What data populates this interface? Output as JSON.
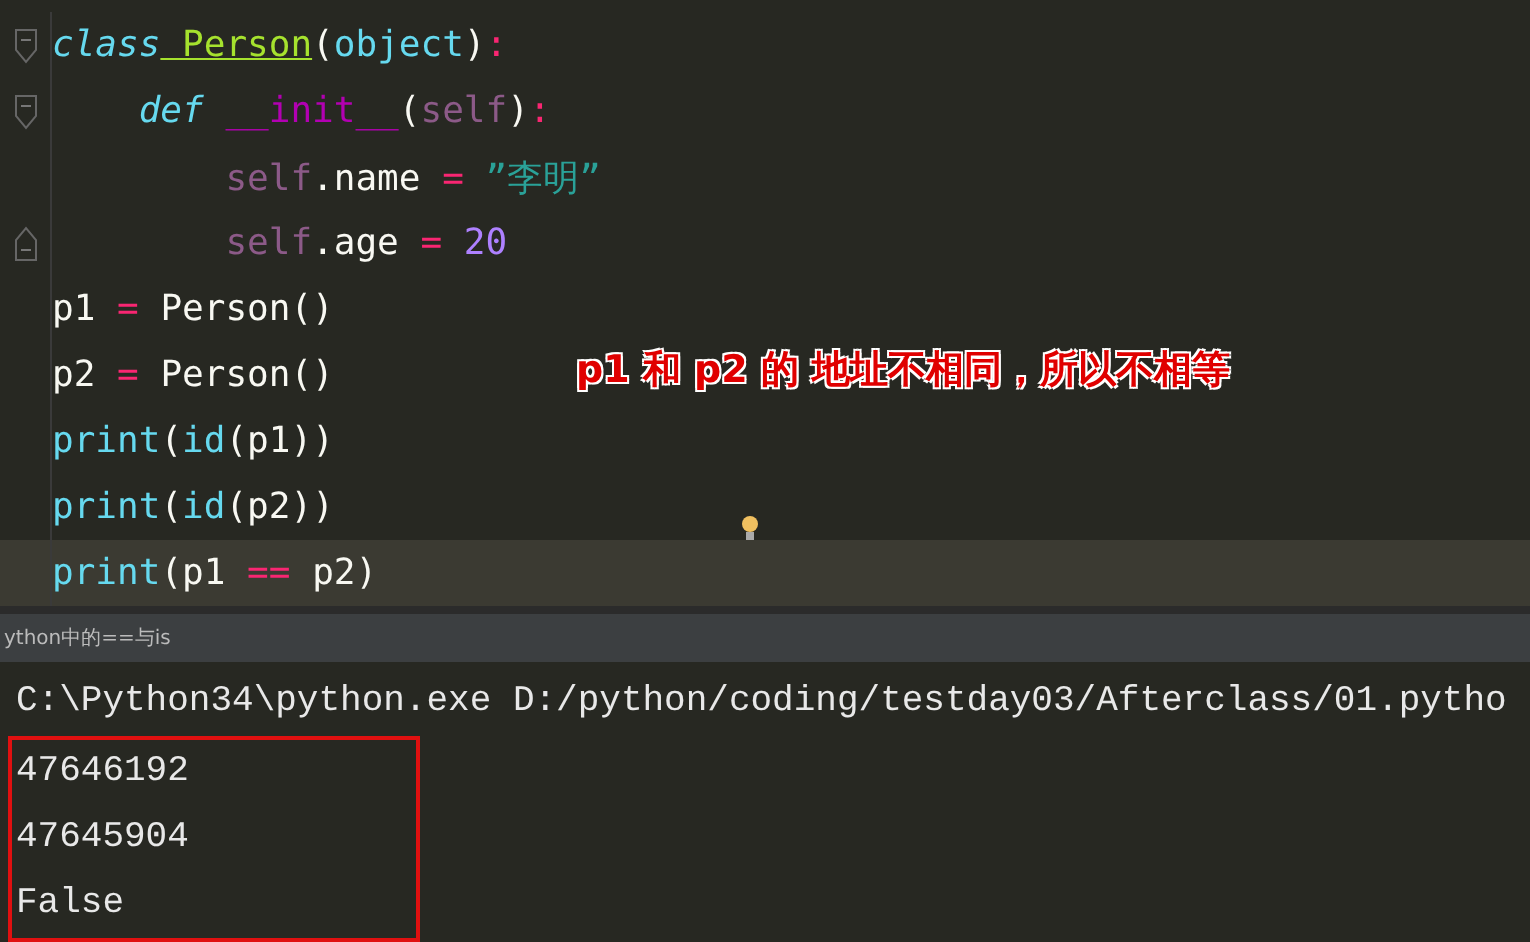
{
  "editor": {
    "lines": [
      {
        "kind": "foldstart",
        "current": false,
        "tokens": [
          {
            "text": "class",
            "kind": "keyword"
          },
          {
            "text": " Person",
            "kind": "classname"
          },
          {
            "text": "(",
            "kind": "plain"
          },
          {
            "text": "object",
            "kind": "builtin"
          },
          {
            "text": ")",
            "kind": "plain"
          },
          {
            "text": ":",
            "kind": "operator"
          }
        ]
      },
      {
        "kind": "foldstart",
        "current": false,
        "tokens": [
          {
            "text": "    def",
            "kind": "keyword"
          },
          {
            "text": " __init__",
            "kind": "magic"
          },
          {
            "text": "(",
            "kind": "plain"
          },
          {
            "text": "self",
            "kind": "self"
          },
          {
            "text": ")",
            "kind": "plain"
          },
          {
            "text": ":",
            "kind": "operator"
          }
        ]
      },
      {
        "kind": "plain",
        "current": false,
        "tokens": [
          {
            "text": "        self",
            "kind": "self"
          },
          {
            "text": ".name ",
            "kind": "plain"
          },
          {
            "text": "=",
            "kind": "operator"
          },
          {
            "text": " ”李明”",
            "kind": "string"
          }
        ]
      },
      {
        "kind": "foldend",
        "current": false,
        "tokens": [
          {
            "text": "        self",
            "kind": "self"
          },
          {
            "text": ".age ",
            "kind": "plain"
          },
          {
            "text": "=",
            "kind": "operator"
          },
          {
            "text": " 20",
            "kind": "number"
          }
        ]
      },
      {
        "kind": "plain",
        "current": false,
        "tokens": [
          {
            "text": "p1 ",
            "kind": "plain"
          },
          {
            "text": "=",
            "kind": "operator"
          },
          {
            "text": " Person()",
            "kind": "plain"
          }
        ]
      },
      {
        "kind": "plain",
        "current": false,
        "tokens": [
          {
            "text": "p2 ",
            "kind": "plain"
          },
          {
            "text": "=",
            "kind": "operator"
          },
          {
            "text": " Person()",
            "kind": "plain"
          }
        ]
      },
      {
        "kind": "plain",
        "current": false,
        "tokens": [
          {
            "text": "print",
            "kind": "builtin"
          },
          {
            "text": "(",
            "kind": "plain"
          },
          {
            "text": "id",
            "kind": "builtin"
          },
          {
            "text": "(p1))",
            "kind": "plain"
          }
        ]
      },
      {
        "kind": "plain",
        "current": false,
        "tokens": [
          {
            "text": "print",
            "kind": "builtin"
          },
          {
            "text": "(",
            "kind": "plain"
          },
          {
            "text": "id",
            "kind": "builtin"
          },
          {
            "text": "(p2))",
            "kind": "plain"
          }
        ]
      },
      {
        "kind": "plain",
        "current": true,
        "tokens": [
          {
            "text": "print",
            "kind": "builtin"
          },
          {
            "text": "(p1 ",
            "kind": "plain"
          },
          {
            "text": "==",
            "kind": "operator"
          },
          {
            "text": " p2)",
            "kind": "plain"
          }
        ]
      }
    ]
  },
  "annotation": "p1 和 p2 的 地址不相同，所以不相等",
  "run_tab": {
    "label": "ython中的==与is"
  },
  "console": {
    "command": "C:\\Python34\\python.exe D:/python/coding/testday03/Afterclass/01.pytho",
    "highlighted_output": [
      "47646192",
      "47645904",
      "False"
    ]
  }
}
